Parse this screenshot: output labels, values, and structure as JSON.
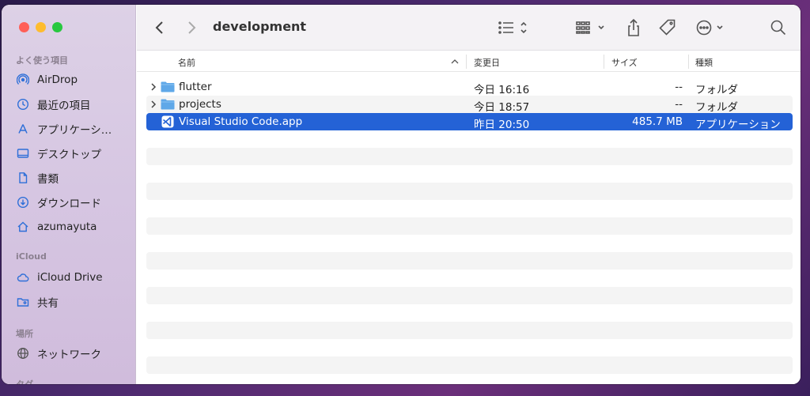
{
  "window": {
    "title": "development"
  },
  "sidebar": {
    "favorites_title": "よく使う項目",
    "favorites": [
      {
        "label": "AirDrop",
        "icon": "airdrop-icon"
      },
      {
        "label": "最近の項目",
        "icon": "clock-icon"
      },
      {
        "label": "アプリケーシ…",
        "icon": "applications-icon"
      },
      {
        "label": "デスクトップ",
        "icon": "desktop-icon"
      },
      {
        "label": "書類",
        "icon": "document-icon"
      },
      {
        "label": "ダウンロード",
        "icon": "download-icon"
      },
      {
        "label": "azumayuta",
        "icon": "home-icon"
      }
    ],
    "icloud_title": "iCloud",
    "icloud": [
      {
        "label": "iCloud Drive",
        "icon": "cloud-icon"
      },
      {
        "label": "共有",
        "icon": "shared-folder-icon"
      }
    ],
    "locations_title": "場所",
    "locations": [
      {
        "label": "ネットワーク",
        "icon": "globe-icon"
      }
    ],
    "tags_title": "タグ"
  },
  "columns": {
    "name": "名前",
    "date": "変更日",
    "size": "サイズ",
    "kind": "種類"
  },
  "files": [
    {
      "name": "flutter",
      "date": "今日 16:16",
      "size": "--",
      "kind": "フォルダ",
      "type": "folder"
    },
    {
      "name": "projects",
      "date": "今日 18:57",
      "size": "--",
      "kind": "フォルダ",
      "type": "folder"
    },
    {
      "name": "Visual Studio Code.app",
      "date": "昨日 20:50",
      "size": "485.7 MB",
      "kind": "アプリケーション",
      "type": "app",
      "selected": true
    }
  ],
  "colors": {
    "selection": "#2462d6",
    "folder": "#5fa8e8"
  }
}
